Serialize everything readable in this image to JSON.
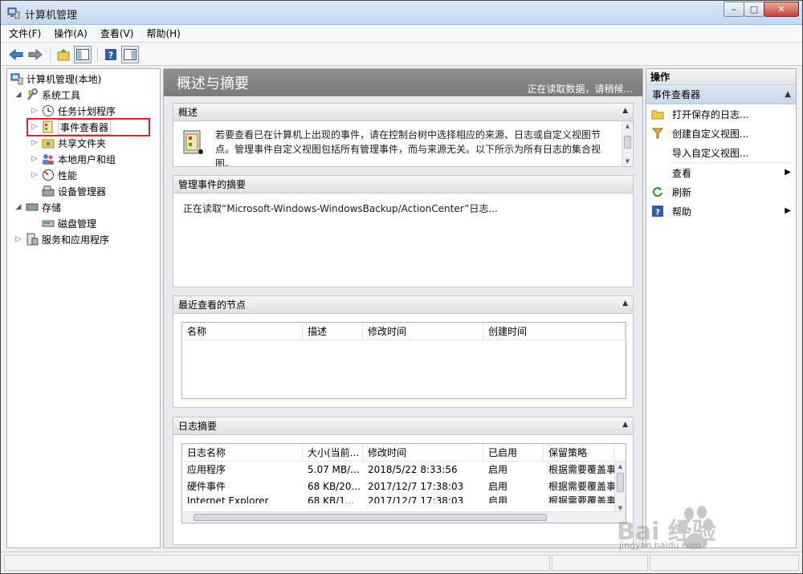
{
  "window": {
    "title": "计算机管理",
    "minimize_label": "‒",
    "maximize_label": "□",
    "close_label": "✕"
  },
  "menu": [
    "文件(F)",
    "操作(A)",
    "查看(V)",
    "帮助(H)"
  ],
  "tree": {
    "root": "计算机管理(本地)",
    "system_tools": "系统工具",
    "task_scheduler": "任务计划程序",
    "event_viewer": "事件查看器",
    "shared_folders": "共享文件夹",
    "local_users": "本地用户和组",
    "performance": "性能",
    "device_manager": "设备管理器",
    "storage": "存储",
    "disk_management": "磁盘管理",
    "services_apps": "服务和应用程序"
  },
  "center": {
    "title": "概述与摘要",
    "status": "正在读取数据，请稍候...",
    "overview": {
      "header": "概述",
      "text": "若要查看已在计算机上出现的事件，请在控制台树中选择相应的来源、日志或自定义视图节点。管理事件自定义视图包括所有管理事件，而与来源无关。以下所示为所有日志的集合视图。"
    },
    "admin_summary": {
      "header": "管理事件的摘要",
      "reading": "正在读取“Microsoft-Windows-WindowsBackup/ActionCenter”日志..."
    },
    "recent": {
      "header": "最近查看的节点",
      "columns": [
        "名称",
        "描述",
        "修改时间",
        "创建时间"
      ]
    },
    "log_summary": {
      "header": "日志摘要",
      "columns": [
        "日志名称",
        "大小(当前...",
        "修改时间",
        "已启用",
        "保留策略"
      ],
      "rows": [
        [
          "应用程序",
          "5.07 MB/...",
          "2018/5/22 8:33:56",
          "启用",
          "根据需要覆盖事"
        ],
        [
          "硬件事件",
          "68 KB/20...",
          "2017/12/7 17:38:03",
          "启用",
          "根据需要覆盖事"
        ],
        [
          "Internet Explorer",
          "68 KB/1...",
          "2017/12/7 17:38:03",
          "启用",
          "根据需要覆盖事"
        ]
      ]
    }
  },
  "actions": {
    "header": "操作",
    "subheader": "事件查看器",
    "items": [
      {
        "label": "打开保存的日志...",
        "icon": "folder-open-icon"
      },
      {
        "label": "创建自定义视图...",
        "icon": "filter-icon"
      },
      {
        "label": "导入自定义视图...",
        "icon": "none"
      },
      {
        "label": "查看",
        "icon": "none",
        "submenu": true
      },
      {
        "label": "刷新",
        "icon": "refresh-icon"
      },
      {
        "label": "帮助",
        "icon": "help-icon",
        "submenu": true
      }
    ]
  },
  "watermark": {
    "brand": "Bai 经验",
    "url": "jingyan.baidu.com"
  },
  "colors": {
    "highlight_box": "#e0202a",
    "header_band": "#808080",
    "action_subheader": "#c8d8ec"
  }
}
